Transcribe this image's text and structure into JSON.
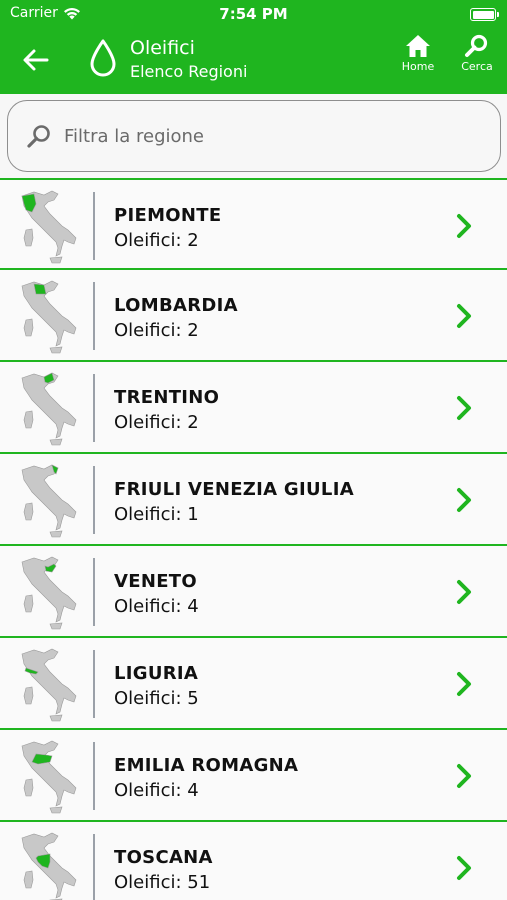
{
  "status_bar": {
    "carrier": "Carrier",
    "time": "7:54 PM"
  },
  "nav": {
    "title": "Oleifici",
    "subtitle": "Elenco Regioni",
    "home_label": "Home",
    "search_label": "Cerca"
  },
  "search": {
    "placeholder": "Filtra la regione",
    "value": ""
  },
  "colors": {
    "accent": "#1fb51f",
    "map_grey": "#c8c8c8"
  },
  "regions": [
    {
      "name": "PIEMONTE",
      "count": "Oleifici: 2",
      "highlight": "piemonte"
    },
    {
      "name": "LOMBARDIA",
      "count": "Oleifici: 2",
      "highlight": "lombardia"
    },
    {
      "name": "TRENTINO",
      "count": "Oleifici: 2",
      "highlight": "trentino"
    },
    {
      "name": "FRIULI VENEZIA GIULIA",
      "count": "Oleifici: 1",
      "highlight": "friuli"
    },
    {
      "name": "VENETO",
      "count": "Oleifici: 4",
      "highlight": "veneto"
    },
    {
      "name": "LIGURIA",
      "count": "Oleifici: 5",
      "highlight": "liguria"
    },
    {
      "name": "EMILIA ROMAGNA",
      "count": "Oleifici: 4",
      "highlight": "emilia"
    },
    {
      "name": "TOSCANA",
      "count": "Oleifici: 51",
      "highlight": "toscana"
    }
  ]
}
